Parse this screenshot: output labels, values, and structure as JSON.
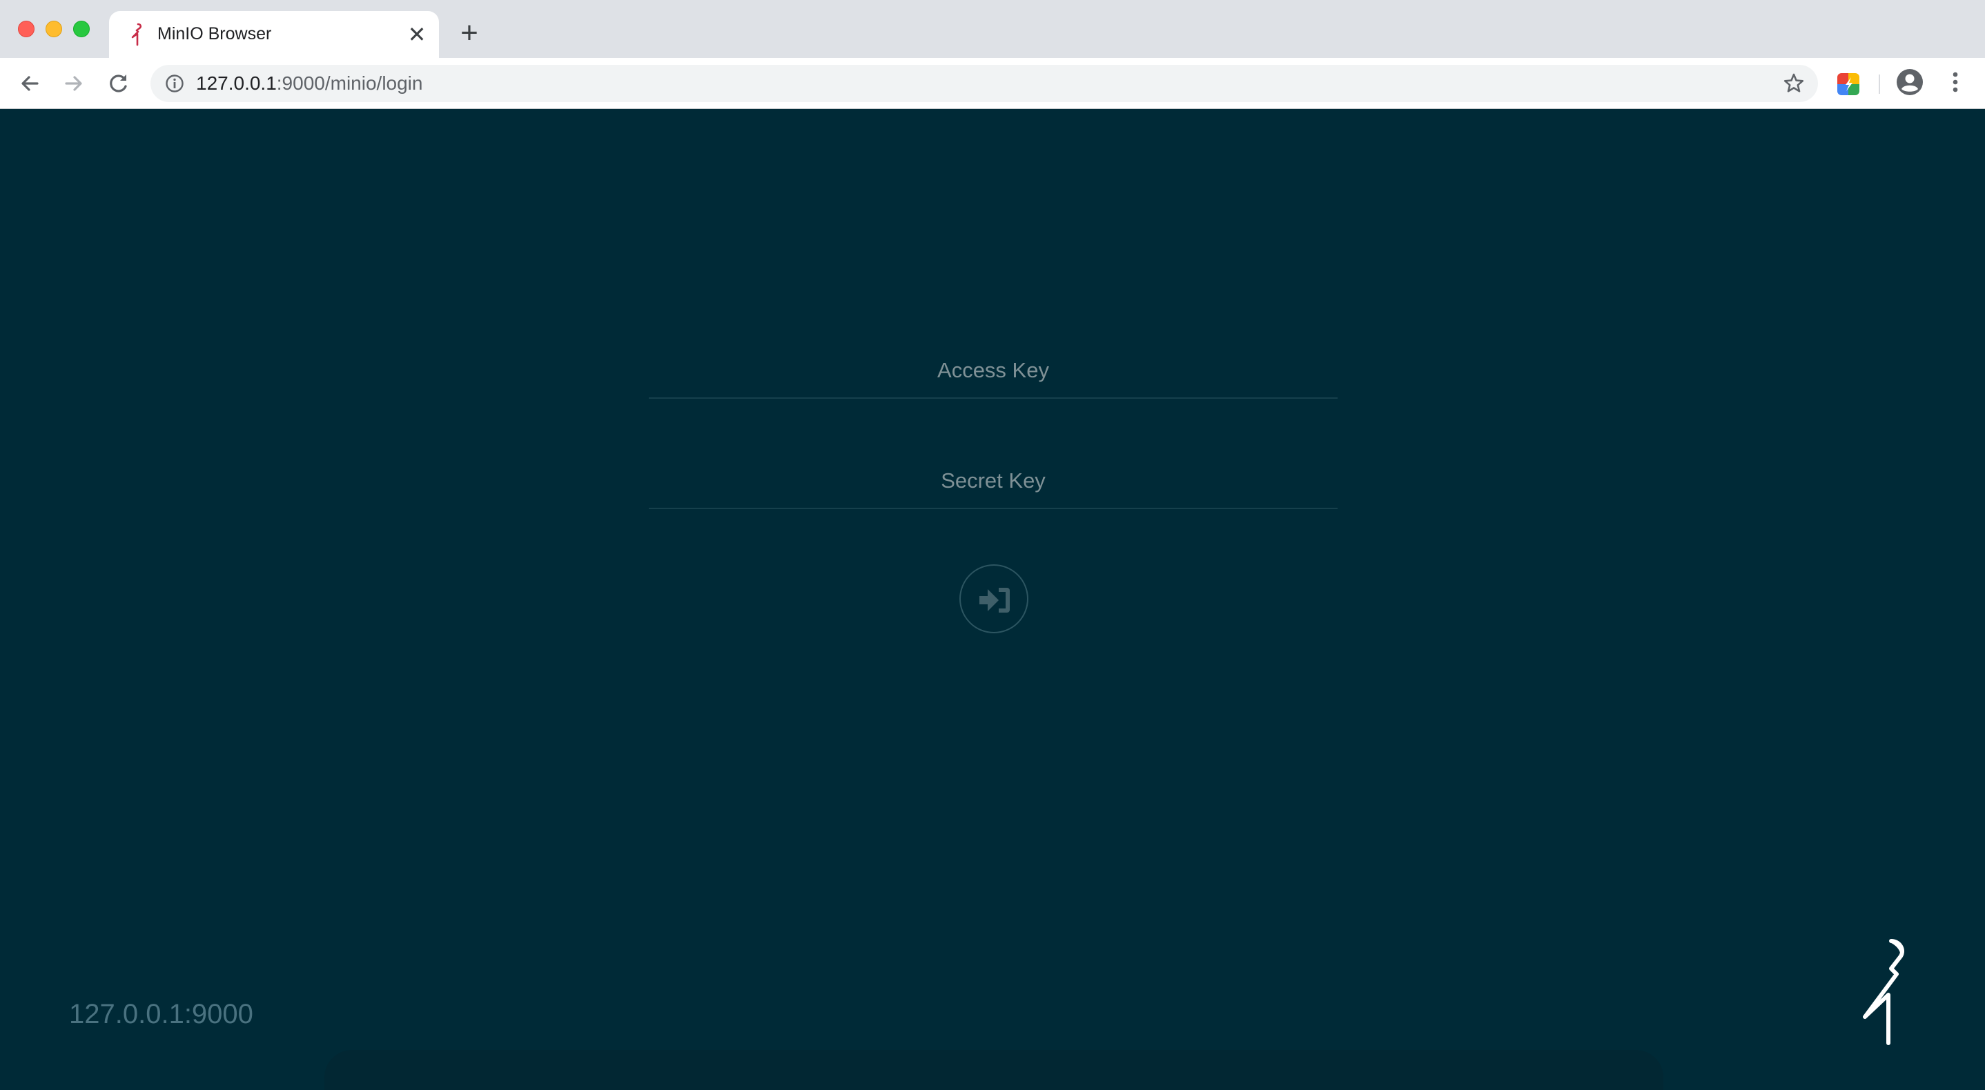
{
  "browser": {
    "tab": {
      "title": "MinIO Browser",
      "close_glyph": "✕",
      "favicon": "minio-flamingo-icon"
    },
    "new_tab_glyph": "+",
    "toolbar": {
      "back_icon": "back-arrow-icon",
      "forward_icon": "forward-arrow-icon",
      "reload_icon": "reload-icon",
      "info_icon": "info-icon",
      "star_icon": "bookmark-star-icon",
      "extension_icon": "extension-icon",
      "profile_icon": "profile-avatar-icon",
      "menu_icon": "kebab-menu-icon"
    },
    "address": {
      "host": "127.0.0.1",
      "rest": ":9000/minio/login"
    },
    "traffic_colors": {
      "close": "#ff5f57",
      "minimize": "#febc2e",
      "maximize": "#28c840"
    }
  },
  "login": {
    "access_key": {
      "placeholder": "Access Key",
      "value": ""
    },
    "secret_key": {
      "placeholder": "Secret Key",
      "value": ""
    },
    "submit_icon": "sign-in-icon"
  },
  "footer": {
    "host": "127.0.0.1:9000",
    "logo": "minio-logo-icon"
  },
  "colors": {
    "page_background": "#002a37",
    "accent_muted": "#4a7280",
    "favicon": "#c72c48"
  }
}
